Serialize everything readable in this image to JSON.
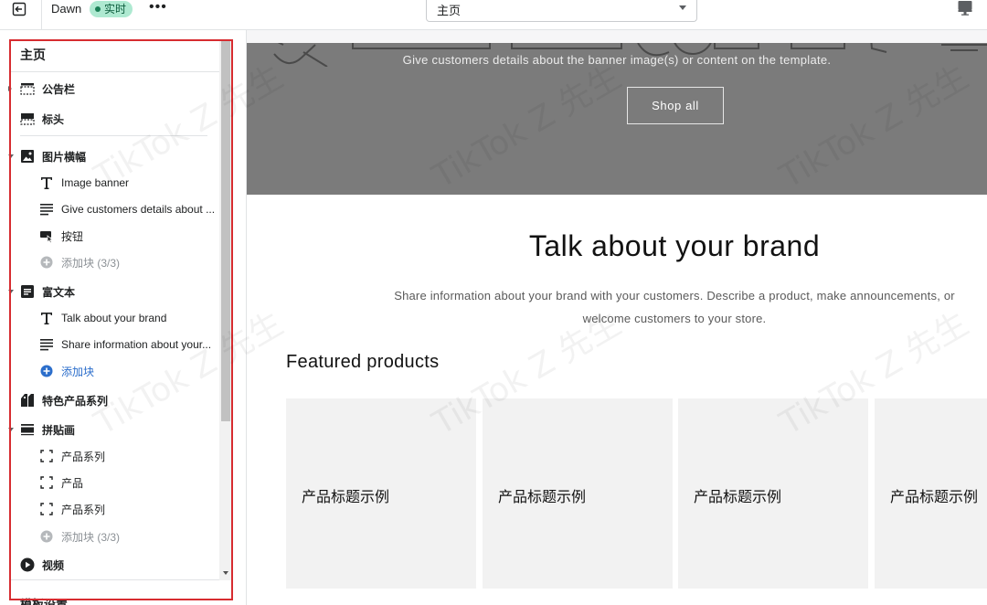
{
  "topbar": {
    "theme_name": "Dawn",
    "live_badge": "实时",
    "more_label": "•••",
    "page_select_value": "主页"
  },
  "sidebar": {
    "title": "主页",
    "items": [
      {
        "label": "公告栏",
        "icon": "announcement-bar-icon",
        "level": "section"
      },
      {
        "label": "标头",
        "icon": "header-icon",
        "level": "section"
      },
      {
        "label": "图片横幅",
        "icon": "image-icon",
        "level": "section"
      },
      {
        "label": "Image banner",
        "icon": "text-heading-icon",
        "level": "child"
      },
      {
        "label": "Give customers details about ...",
        "icon": "text-block-icon",
        "level": "child"
      },
      {
        "label": "按钮",
        "icon": "button-icon",
        "level": "child"
      },
      {
        "label": "添加块 (3/3)",
        "icon": "add-circle-icon",
        "level": "child"
      },
      {
        "label": "富文本",
        "icon": "rich-text-icon",
        "level": "section"
      },
      {
        "label": "Talk about your brand",
        "icon": "text-heading-icon",
        "level": "child"
      },
      {
        "label": "Share information about your...",
        "icon": "text-block-icon",
        "level": "child"
      },
      {
        "label": "添加块",
        "icon": "add-circle-icon",
        "level": "child"
      },
      {
        "label": "特色产品系列",
        "icon": "collection-tag-icon",
        "level": "section"
      },
      {
        "label": "拼贴画",
        "icon": "collage-icon",
        "level": "section"
      },
      {
        "label": "产品系列",
        "icon": "placeholder-frame-icon",
        "level": "child"
      },
      {
        "label": "产品",
        "icon": "placeholder-frame-icon",
        "level": "child"
      },
      {
        "label": "产品系列",
        "icon": "placeholder-frame-icon",
        "level": "child"
      },
      {
        "label": "添加块 (3/3)",
        "icon": "add-circle-icon",
        "level": "child"
      },
      {
        "label": "视频",
        "icon": "play-icon",
        "level": "section"
      }
    ],
    "theme_settings": "模板设置"
  },
  "preview": {
    "banner_text": "Give customers details about the banner image(s) or content on the template.",
    "shop_all": "Shop all",
    "brand_title": "Talk about your brand",
    "brand_text": "Share information about your brand with your customers. Describe a product, make announcements, or welcome customers to your store.",
    "featured_title": "Featured products",
    "products": [
      {
        "title": "产品标题示例"
      },
      {
        "title": "产品标题示例"
      },
      {
        "title": "产品标题示例"
      },
      {
        "title": "产品标题示例"
      }
    ]
  },
  "watermark": "TikTok Z 先生",
  "colors": {
    "live_badge_bg": "#aee9d1",
    "highlight_border": "#d72c30",
    "add_block_blue": "#2c6ecb",
    "banner_bg": "#7b7b7b"
  }
}
